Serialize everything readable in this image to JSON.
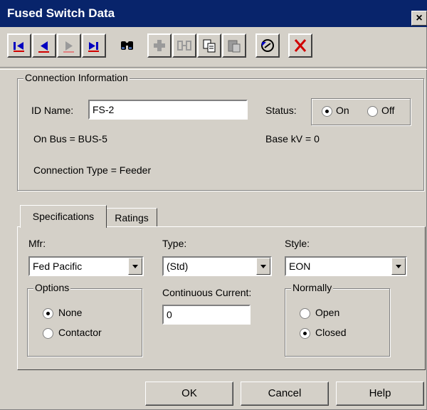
{
  "window": {
    "title": "Fused Switch Data",
    "close": "×"
  },
  "toolbar": {
    "buttons": [
      "first-record",
      "previous-record",
      "next-record",
      "last-record",
      "find",
      "add",
      "insert",
      "copy",
      "paste",
      "undo",
      "delete"
    ]
  },
  "connection": {
    "group_label": "Connection Information",
    "id_label": "ID Name:",
    "id_value": "FS-2",
    "status_label": "Status:",
    "status_on": "On",
    "status_off": "Off",
    "status_selected": "On",
    "on_bus": "On Bus =  BUS-5",
    "base_kv": "Base kV =   0",
    "connection_type": "Connection Type =   Feeder"
  },
  "tabs": [
    {
      "label": "Specifications",
      "active": true
    },
    {
      "label": "Ratings",
      "active": false
    }
  ],
  "specs": {
    "mfr_label": "Mfr:",
    "mfr_value": "Fed Pacific",
    "type_label": "Type:",
    "type_value": "(Std)",
    "style_label": "Style:",
    "style_value": "EON",
    "options_label": "Options",
    "option_none": "None",
    "option_contactor": "Contactor",
    "options_selected": "None",
    "current_label": "Continuous Current:",
    "current_value": "0",
    "normally_label": "Normally",
    "normally_open": "Open",
    "normally_closed": "Closed",
    "normally_selected": "Closed"
  },
  "buttons": {
    "ok": "OK",
    "cancel": "Cancel",
    "help": "Help"
  },
  "colors": {
    "titlebar": "#08246b",
    "face": "#d4d0c8",
    "nav_blue": "#0000c0",
    "delete_red": "#d00000"
  }
}
